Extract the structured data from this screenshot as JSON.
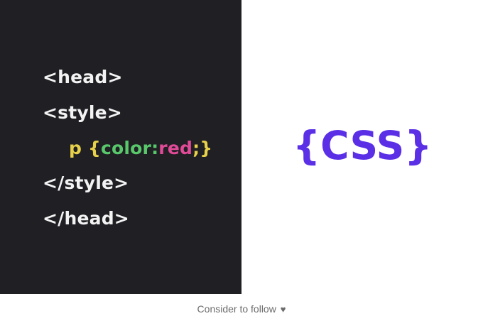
{
  "code": {
    "line1": "<head>",
    "line2": "<style>",
    "line3": {
      "selector": "p",
      "open_brace": "{",
      "property": "color",
      "colon": ":",
      "value": "red",
      "semicolon": ";",
      "close_brace": "}"
    },
    "line4": "</style>",
    "line5": "</head>"
  },
  "logo": {
    "text": "{CSS}",
    "color": "#5b2fe6"
  },
  "footer": {
    "text": "Consider to follow",
    "heart": "♥"
  },
  "colors": {
    "code_background": "#1f1f24",
    "tag_text": "#f3f3f3",
    "selector": "#e7d04a",
    "property": "#59c86b",
    "value": "#e04a97"
  }
}
